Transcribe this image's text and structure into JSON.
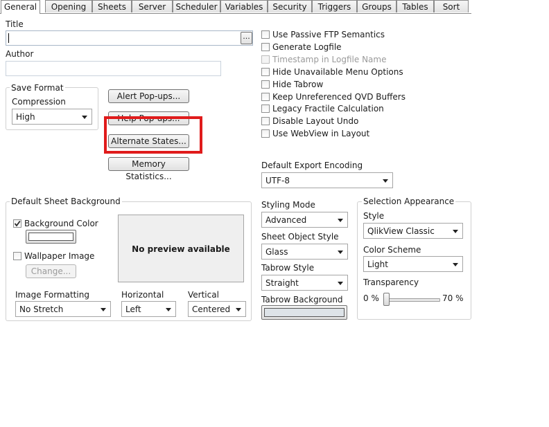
{
  "tabs": [
    {
      "label": "General",
      "active": true
    },
    {
      "label": "Opening"
    },
    {
      "label": "Sheets"
    },
    {
      "label": "Server"
    },
    {
      "label": "Scheduler"
    },
    {
      "label": "Variables"
    },
    {
      "label": "Security"
    },
    {
      "label": "Triggers"
    },
    {
      "label": "Groups"
    },
    {
      "label": "Tables"
    },
    {
      "label": "Sort"
    }
  ],
  "title_field": {
    "label": "Title",
    "value": "",
    "browse_label": "..."
  },
  "author_field": {
    "label": "Author",
    "value": ""
  },
  "save_format": {
    "group_label": "Save Format",
    "compression_label": "Compression",
    "compression_value": "High"
  },
  "buttons": {
    "alert_popups": "Alert Pop-ups...",
    "help_popups": "Help Pop-ups...",
    "alternate_states": "Alternate States...",
    "memory_statistics": "Memory Statistics..."
  },
  "checkboxes": [
    {
      "label": "Use Passive FTP Semantics",
      "checked": false,
      "enabled": true
    },
    {
      "label": "Generate Logfile",
      "checked": false,
      "enabled": true
    },
    {
      "label": "Timestamp in Logfile Name",
      "checked": false,
      "enabled": false
    },
    {
      "label": "Hide Unavailable Menu Options",
      "checked": false,
      "enabled": true
    },
    {
      "label": "Hide Tabrow",
      "checked": false,
      "enabled": true
    },
    {
      "label": "Keep Unreferenced QVD Buffers",
      "checked": false,
      "enabled": true
    },
    {
      "label": "Legacy Fractile Calculation",
      "checked": false,
      "enabled": true
    },
    {
      "label": "Disable Layout Undo",
      "checked": false,
      "enabled": true
    },
    {
      "label": "Use WebView in Layout",
      "checked": false,
      "enabled": true
    }
  ],
  "export_encoding": {
    "label": "Default Export Encoding",
    "value": "UTF-8"
  },
  "sheet_background": {
    "group_label": "Default Sheet Background",
    "background_color_label": "Background Color",
    "background_color_checked": true,
    "swatch_color": "#ffffff",
    "wallpaper_label": "Wallpaper Image",
    "wallpaper_checked": false,
    "change_label": "Change...",
    "preview_text": "No preview available",
    "image_formatting_label": "Image Formatting",
    "image_formatting_value": "No Stretch",
    "horizontal_label": "Horizontal",
    "horizontal_value": "Left",
    "vertical_label": "Vertical",
    "vertical_value": "Centered"
  },
  "styling": {
    "styling_mode_label": "Styling Mode",
    "styling_mode_value": "Advanced",
    "sheet_object_style_label": "Sheet Object Style",
    "sheet_object_style_value": "Glass",
    "tabrow_style_label": "Tabrow Style",
    "tabrow_style_value": "Straight",
    "tabrow_background_label": "Tabrow Background",
    "tabrow_background_color": "#dde3e8"
  },
  "selection_appearance": {
    "group_label": "Selection Appearance",
    "style_label": "Style",
    "style_value": "QlikView Classic",
    "color_scheme_label": "Color Scheme",
    "color_scheme_value": "Light",
    "transparency_label": "Transparency",
    "min_label": "0 %",
    "max_label": "70 %",
    "transparency_value_fraction": 0
  },
  "colors": {
    "highlight_box": "#e01b1b",
    "tab_border": "#8a8a8a"
  }
}
